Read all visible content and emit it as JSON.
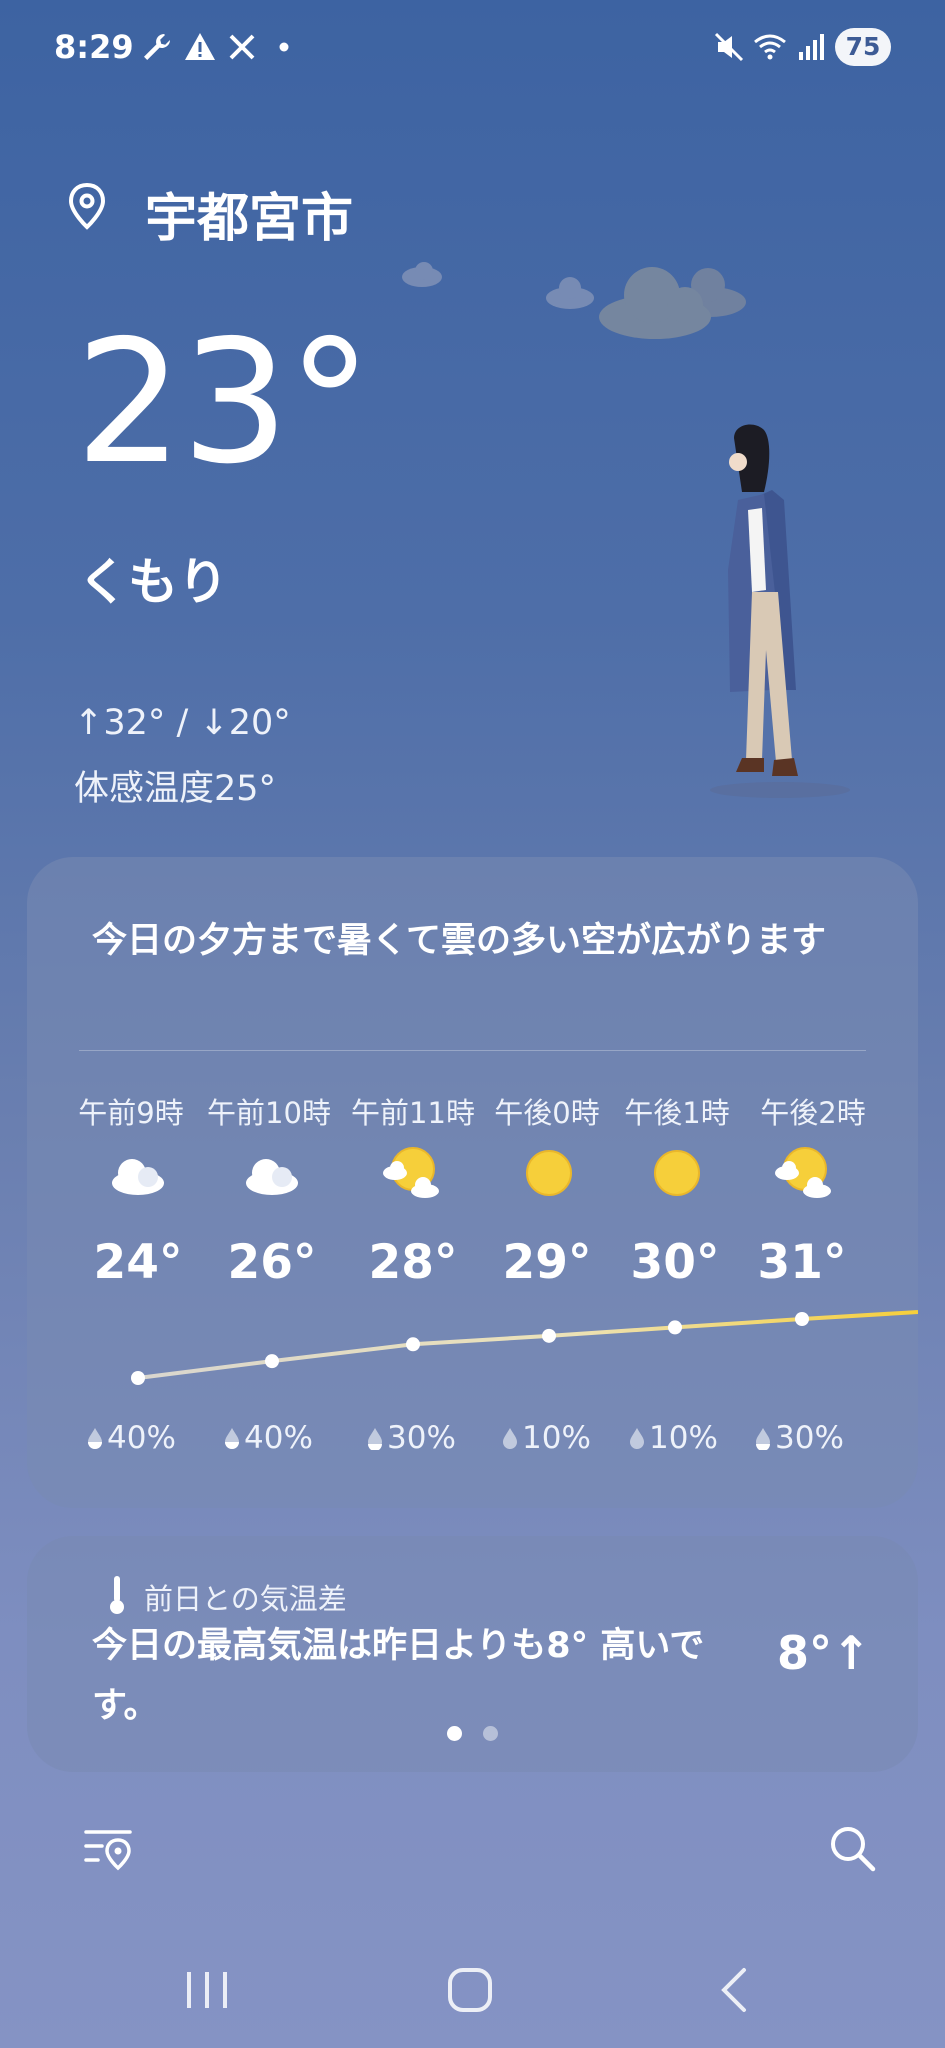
{
  "status_bar": {
    "time": "8:29",
    "battery": "75",
    "icons": [
      "wrench-icon",
      "warning-icon",
      "x-app-icon",
      "dot-icon",
      "mute-icon",
      "wifi-icon",
      "signal-icon",
      "battery-icon"
    ]
  },
  "location": {
    "name": "宇都宮市",
    "icon": "location-pin-icon"
  },
  "current": {
    "temperature": "23°",
    "condition": "くもり",
    "high_low": "↑32° / ↓20°",
    "feels_like": "体感温度25°"
  },
  "forecast": {
    "summary": "今日の夕方まで暑くて雲の多い空が広がります",
    "hours": [
      {
        "time": "午前9時",
        "icon": "cloud-icon",
        "temp": "24°",
        "precip": "40%"
      },
      {
        "time": "午前10時",
        "icon": "cloud-icon",
        "temp": "26°",
        "precip": "40%"
      },
      {
        "time": "午前11時",
        "icon": "sun-cloud-icon",
        "temp": "28°",
        "precip": "30%"
      },
      {
        "time": "午後0時",
        "icon": "sun-icon",
        "temp": "29°",
        "precip": "10%"
      },
      {
        "time": "午後1時",
        "icon": "sun-icon",
        "temp": "30°",
        "precip": "10%"
      },
      {
        "time": "午後2時",
        "icon": "sun-cloud-icon",
        "temp": "31°",
        "precip": "30%"
      }
    ]
  },
  "temp_diff": {
    "label": "前日との気温差",
    "text": "今日の最高気温は昨日よりも8° 高いです。",
    "value": "8°↑",
    "page_indicator": {
      "total": 2,
      "active": 1
    }
  },
  "colors": {
    "accent_yellow": "#f6cf3a",
    "card_bg": "#7a8ab2",
    "background_top": "#3d63a2",
    "background_bottom": "#8593c4"
  },
  "bottom_bar": {
    "left_icon": "location-list-icon",
    "right_icon": "search-icon"
  },
  "nav_bar": [
    "recent-apps-button",
    "home-button",
    "back-button"
  ]
}
